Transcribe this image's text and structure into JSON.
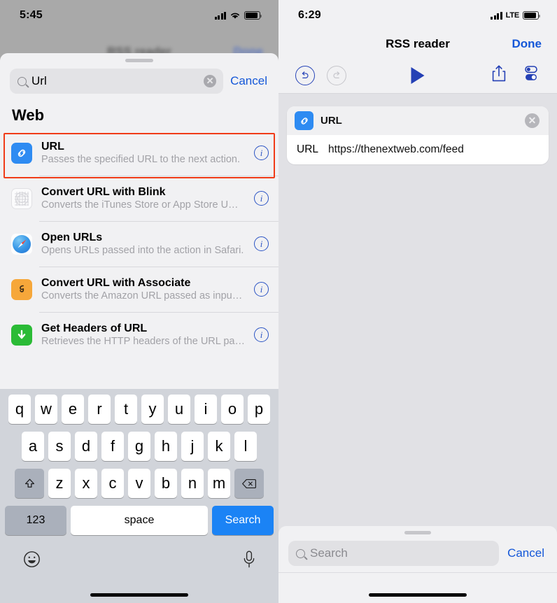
{
  "left_screen": {
    "status_bar": {
      "time": "5:45",
      "signal_icon": "cellular-bars-icon",
      "wifi_icon": "wifi-icon",
      "battery_icon": "battery-icon"
    },
    "background_nav": {
      "title": "RSS reader",
      "done_label": "Done"
    },
    "search": {
      "value": "Url",
      "placeholder": "Search",
      "cancel_label": "Cancel",
      "search_icon": "search-icon",
      "clear_icon": "clear-icon"
    },
    "section_header": "Web",
    "results": [
      {
        "title": "URL",
        "subtitle": "Passes the specified URL to the next action.",
        "icon": "link-icon",
        "icon_color": "#2e8bf2",
        "info_label": "i",
        "highlighted": true
      },
      {
        "title": "Convert URL with Blink",
        "subtitle": "Converts the iTunes Store or App Store UR…",
        "icon": "blink-grid-icon",
        "icon_color": "#fbfbfc",
        "info_label": "i",
        "highlighted": false
      },
      {
        "title": "Open URLs",
        "subtitle": "Opens URLs passed into the action in Safari.",
        "icon": "safari-compass-icon",
        "icon_color": "#3a9ae8",
        "info_label": "i",
        "highlighted": false
      },
      {
        "title": "Convert URL with Associate",
        "subtitle": "Converts the Amazon URL passed as input…",
        "icon": "amazon-icon",
        "icon_color": "#f6a73a",
        "info_label": "i",
        "highlighted": false
      },
      {
        "title": "Get Headers of URL",
        "subtitle": "Retrieves the HTTP headers of the URL pa…",
        "icon": "download-arrow-icon",
        "icon_color": "#2bbb36",
        "info_label": "i",
        "highlighted": false
      }
    ],
    "highlight_color": "#f03c18",
    "keyboard": {
      "row1": [
        "q",
        "w",
        "e",
        "r",
        "t",
        "y",
        "u",
        "i",
        "o",
        "p"
      ],
      "row2": [
        "a",
        "s",
        "d",
        "f",
        "g",
        "h",
        "j",
        "k",
        "l"
      ],
      "row3": [
        "z",
        "x",
        "c",
        "v",
        "b",
        "n",
        "m"
      ],
      "shift_icon": "shift-icon",
      "backspace_icon": "backspace-icon",
      "numbers_label": "123",
      "space_label": "space",
      "return_label": "Search",
      "return_color": "#1b83f5",
      "emoji_icon": "emoji-icon",
      "dictation_icon": "microphone-icon"
    }
  },
  "right_screen": {
    "status_bar": {
      "time": "6:29",
      "signal_icon": "cellular-bars-icon",
      "network_label": "LTE",
      "battery_icon": "battery-icon"
    },
    "nav": {
      "title": "RSS reader",
      "done_label": "Done"
    },
    "toolbar": {
      "undo_icon": "undo-icon",
      "redo_icon": "redo-icon",
      "play_icon": "play-icon",
      "share_icon": "share-icon",
      "settings_icon": "toggles-icon",
      "accent_color": "#2440b5"
    },
    "action_card": {
      "icon": "link-icon",
      "icon_color": "#2e8bf2",
      "title": "URL",
      "remove_icon": "close-icon",
      "field_label": "URL",
      "field_value": "https://thenextweb.com/feed"
    },
    "bottom_search": {
      "placeholder": "Search",
      "cancel_label": "Cancel",
      "search_icon": "search-icon"
    }
  }
}
